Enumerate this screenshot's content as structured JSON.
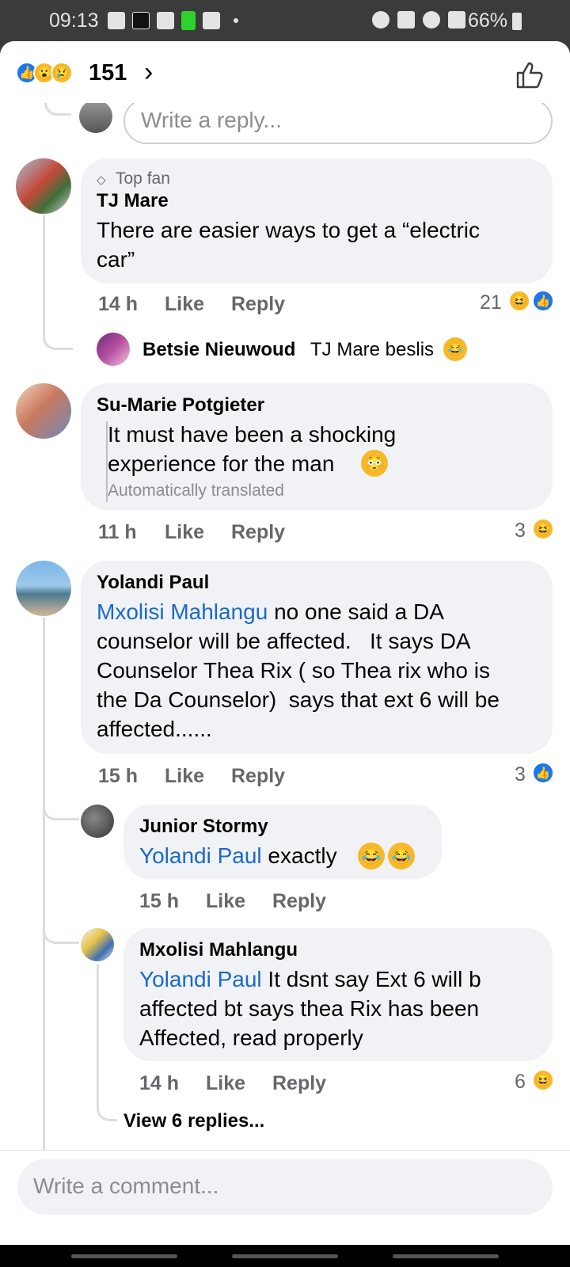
{
  "status_bar": {
    "time": "09:13",
    "battery": "66%"
  },
  "reactions": {
    "count": "151",
    "icons": [
      "like",
      "wow",
      "sad"
    ]
  },
  "top_reply_placeholder": "Write a reply...",
  "comments": [
    {
      "badge": "Top fan",
      "author": "TJ Mare",
      "text": [
        "There are easier ways to get a “electric",
        "car”"
      ],
      "time": "14 h",
      "like": "Like",
      "reply": "Reply",
      "reaction_count": "21",
      "reply_preview": {
        "author": "Betsie Nieuwoud",
        "text": "TJ Mare beslis"
      }
    },
    {
      "author": "Su-Marie Potgieter",
      "text": [
        "It must have been a shocking",
        "experience for the man"
      ],
      "translated": "Automatically translated",
      "time": "11 h",
      "like": "Like",
      "reply": "Reply",
      "reaction_count": "3"
    },
    {
      "author": "Yolandi Paul",
      "mention": "Mxolisi Mahlangu",
      "text": [
        " no one said a DA",
        "counselor will be affected.   It says DA",
        "Counselor Thea Rix ( so Thea rix who is",
        "the Da Counselor)  says that ext 6 will be",
        "affected......"
      ],
      "time": "15 h",
      "like": "Like",
      "reply": "Reply",
      "reaction_count": "3",
      "replies": [
        {
          "author": "Junior Stormy",
          "mention": "Yolandi Paul",
          "text": " exactly",
          "time": "15 h",
          "like": "Like",
          "reply": "Reply"
        },
        {
          "author": "Mxolisi Mahlangu",
          "mention": "Yolandi Paul",
          "text": [
            " It dsnt say Ext 6 will b",
            "affected bt says thea Rix has been",
            "Affected, read properly"
          ],
          "time": "14 h",
          "like": "Like",
          "reply": "Reply",
          "reaction_count": "6"
        }
      ],
      "view_replies": "View 6 replies..."
    }
  ],
  "composer": {
    "placeholder": "Write a comment..."
  },
  "colors": {
    "accent": "#1877f2",
    "mention": "#1a6ac8",
    "bubble": "#f0f2f5",
    "muted": "#65676b"
  }
}
